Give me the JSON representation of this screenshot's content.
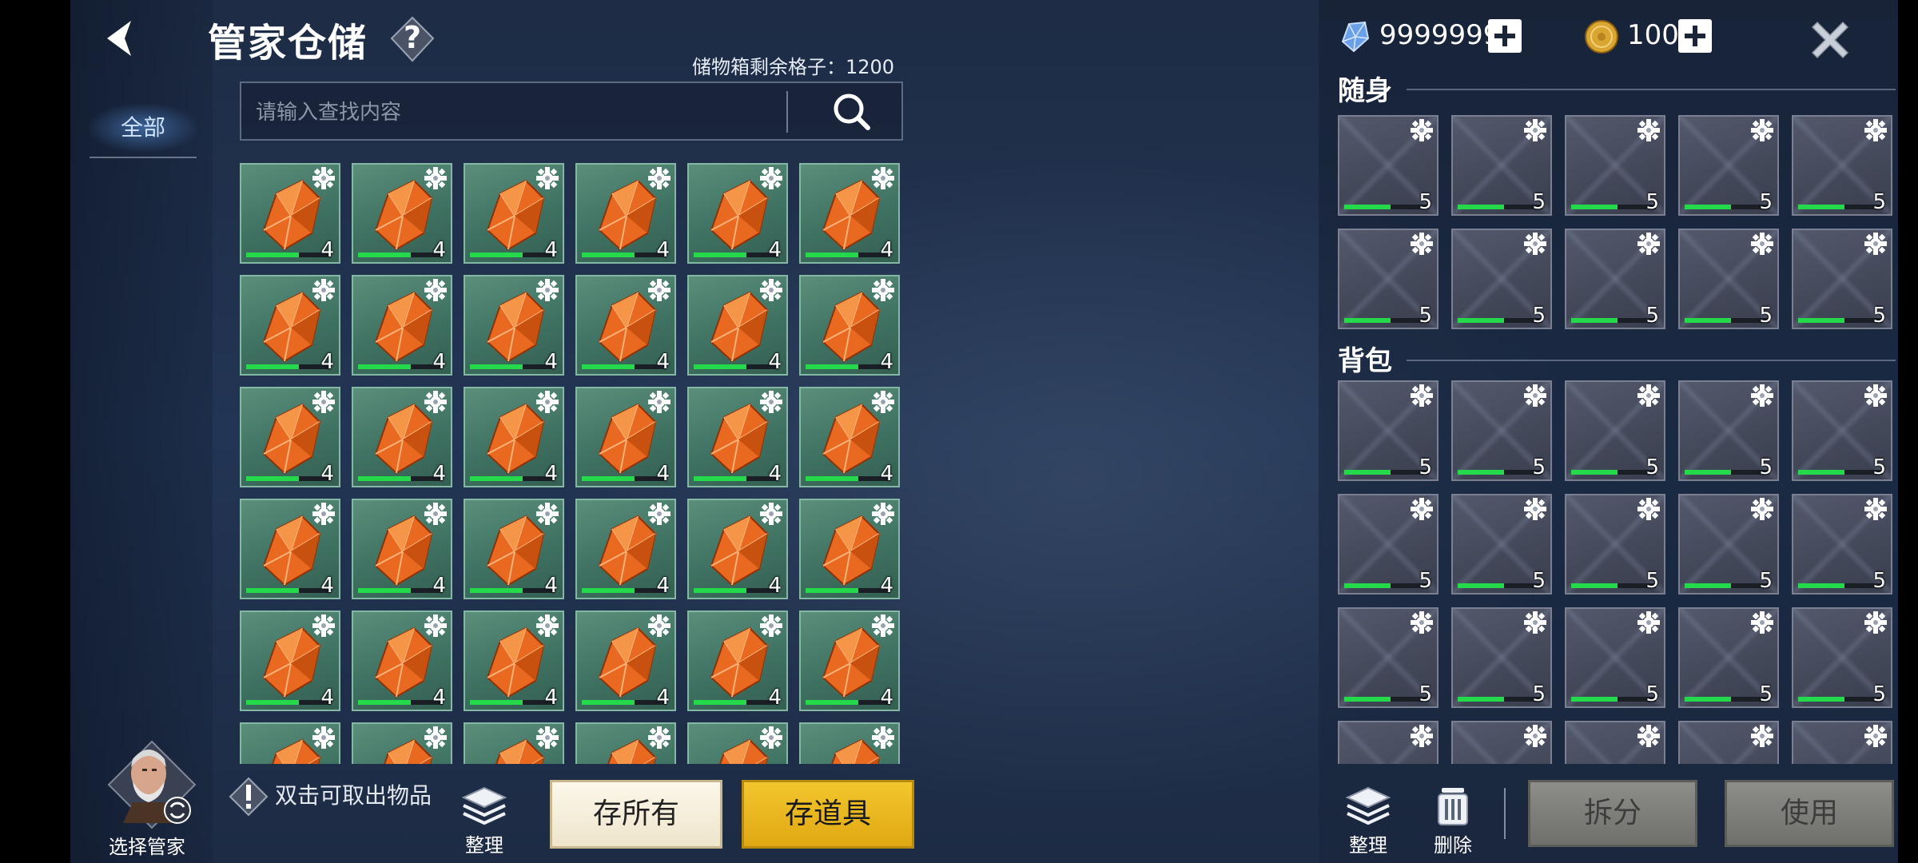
{
  "header": {
    "title": "管家仓储",
    "capacity_text": "储物箱剩余格子：1200"
  },
  "sidebar": {
    "tabs": [
      {
        "label": "全部"
      }
    ]
  },
  "search": {
    "placeholder": "请输入查找内容"
  },
  "storage": {
    "item_icon": "orange-crystal-icon",
    "item_count": "4",
    "durability_fraction": 0.62,
    "rows_visible": 6,
    "cols": 6
  },
  "currency": {
    "gem_amount": "9999999",
    "coin_amount": "100"
  },
  "carry_section": {
    "title": "随身",
    "slot_count": "5",
    "durability_fraction": 0.55,
    "rows": 2,
    "cols": 5
  },
  "bag_section": {
    "title": "背包",
    "slot_count": "5",
    "durability_fraction": 0.55,
    "rows_visible": 4,
    "cols": 5
  },
  "footer": {
    "butler_label": "选择管家",
    "hint_text": "双击可取出物品",
    "sort_label": "整理",
    "store_all_label": "存所有",
    "store_items_label": "存道具",
    "sort_right_label": "整理",
    "delete_label": "删除",
    "split_label": "拆分",
    "use_label": "使用"
  },
  "colors": {
    "accent_yellow": "#f3c62e",
    "durability_green": "#24d94a",
    "slot_green": "#3f7262",
    "slot_gray": "#434859"
  }
}
